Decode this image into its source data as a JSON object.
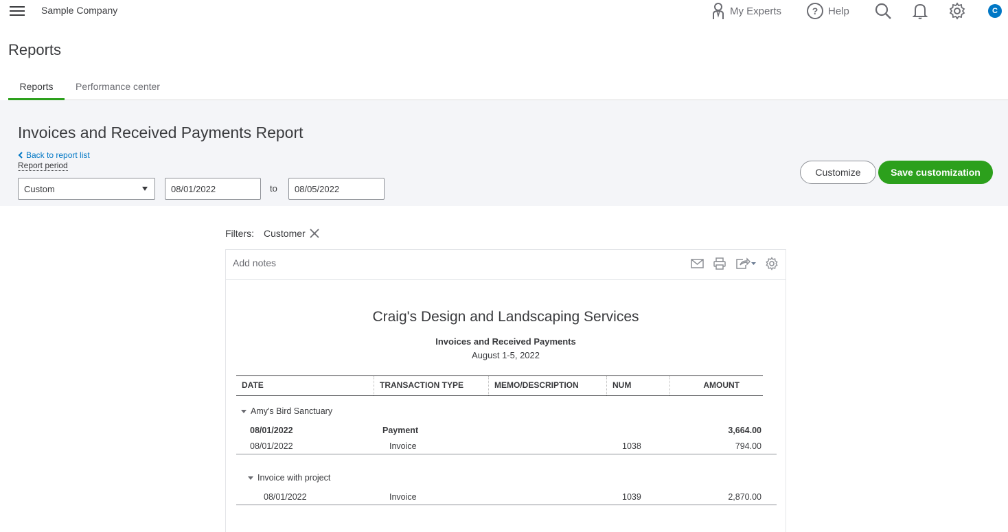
{
  "topbar": {
    "company": "Sample Company",
    "my_experts": "My Experts",
    "help": "Help",
    "avatar_letter": "C",
    "icons": [
      "menu-icon",
      "person-icon",
      "help-icon",
      "search-icon",
      "bell-icon",
      "gear-icon"
    ]
  },
  "page": {
    "title": "Reports",
    "tabs": [
      {
        "label": "Reports",
        "active": true
      },
      {
        "label": "Performance center",
        "active": false
      }
    ]
  },
  "report_header": {
    "title": "Invoices and Received Payments Report",
    "back_link": "Back to report list",
    "period_label": "Report period",
    "period_select": "Custom",
    "date_from": "08/01/2022",
    "to_label": "to",
    "date_to": "08/05/2022",
    "customize_label": "Customize",
    "save_label": "Save customization"
  },
  "filters": {
    "label": "Filters:",
    "chips": [
      "Customer"
    ]
  },
  "report": {
    "add_notes": "Add notes",
    "company_name": "Craig's Design and Landscaping Services",
    "name": "Invoices and Received Payments",
    "dates": "August 1-5, 2022",
    "columns": [
      "DATE",
      "TRANSACTION TYPE",
      "MEMO/DESCRIPTION",
      "NUM",
      "AMOUNT"
    ],
    "groups": [
      {
        "label": "Amy's Bird Sanctuary",
        "rows": [
          {
            "date": "08/01/2022",
            "type": "Payment",
            "memo": "",
            "num": "",
            "amount": "3,664.00",
            "bold": true
          },
          {
            "date": "08/01/2022",
            "type": "Invoice",
            "memo": "",
            "num": "1038",
            "amount": "794.00",
            "bold": false
          }
        ]
      },
      {
        "label": "Invoice with project",
        "rows": [
          {
            "date": "08/01/2022",
            "type": "Invoice",
            "memo": "",
            "num": "1039",
            "amount": "2,870.00",
            "bold": false
          }
        ]
      }
    ]
  },
  "colors": {
    "accent_green": "#2ca01c",
    "link_blue": "#0077c5",
    "header_bg": "#f4f5f8",
    "text": "#393a3d"
  }
}
